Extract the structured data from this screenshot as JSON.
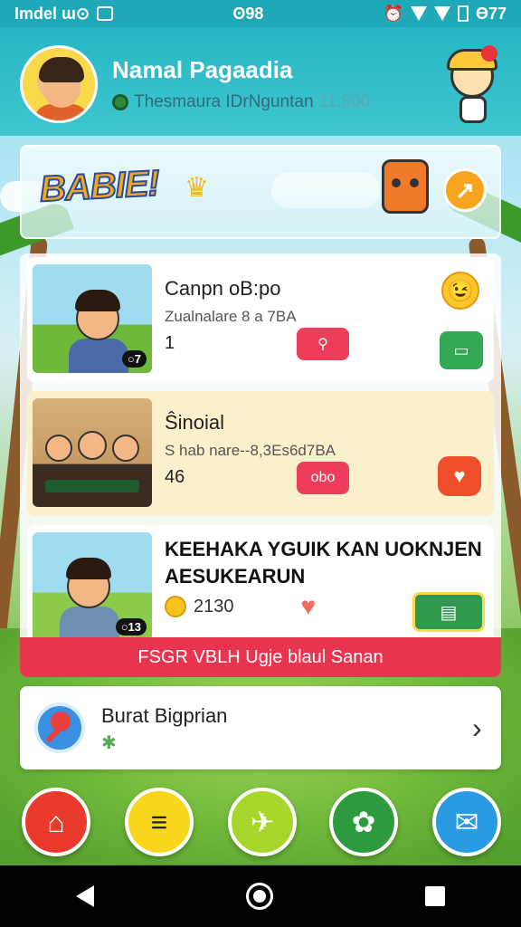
{
  "status_bar": {
    "left_text": "Imdel ɯ⊙",
    "time": "ʘ98",
    "battery_text": "Ɵ77"
  },
  "header": {
    "user_name": "Namal Pagaadia",
    "subtitle": "Thesmaura IDrNguntan",
    "count": "11.800"
  },
  "banner": {
    "logo_text": "BABIE!",
    "action_icon": "↗"
  },
  "cards": [
    {
      "title": "Canpn oB:po",
      "subtitle": "Zualnalare 8 a 7BA",
      "number": "1",
      "pill_icon": "⚲",
      "badge_text": "▭"
    },
    {
      "title": "Ŝinoial",
      "subtitle": "S hab nare--8,3Es6d7BA",
      "number": "46",
      "pill_text": "obo",
      "badge_icon": "♥"
    },
    {
      "title_line1": "KEEHAKA YGUIK KAN UOKNJEN",
      "title_line2": "AESUKEARUN",
      "stats": "2130",
      "thumb_badge": "○13",
      "icon_text": "▤"
    }
  ],
  "card_thumb_badges": [
    "○7",
    "○13"
  ],
  "promo": {
    "text": "FSGR VBLH Ugje blaul Sanan"
  },
  "list_item": {
    "title": "Burat Bigprian",
    "sub_icon": "✱"
  },
  "nav": {
    "home_icon": "⌂",
    "menu_icon": "≡",
    "game_icon": "✈",
    "settings_icon": "✿",
    "mail_icon": "✉"
  }
}
